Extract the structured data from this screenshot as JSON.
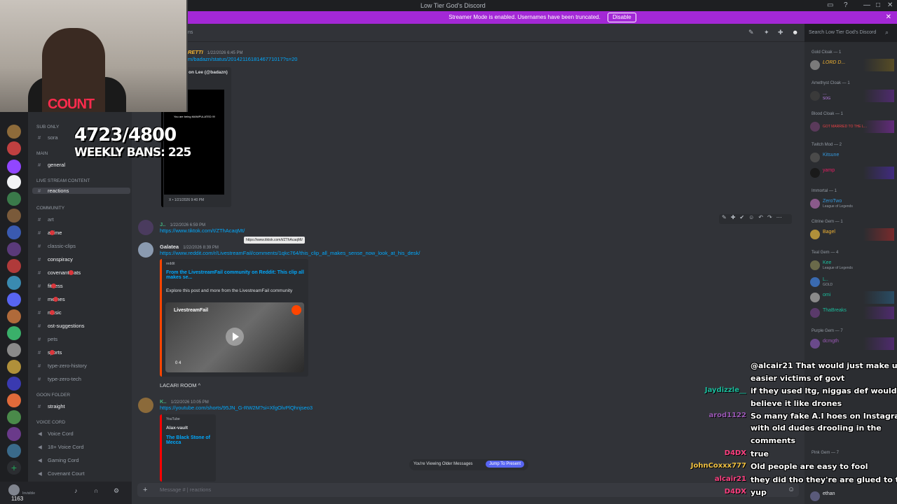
{
  "window": {
    "title": "Low Tier God's Discord"
  },
  "banner": {
    "text": "Streamer Mode is enabled. Usernames have been truncated.",
    "disable_label": "Disable"
  },
  "search": {
    "placeholder": "Search Low Tier God's Discord"
  },
  "overlay": {
    "counter": "4723/4800",
    "weekly_bans": "WEEKLY BANS: 225",
    "shirt_text": "COUNT"
  },
  "sidebar": {
    "categories": [
      {
        "label": "SUB ONLY"
      },
      {
        "label": "MAIN"
      },
      {
        "label": "LIVE STREAM CONTENT"
      },
      {
        "label": "COMMUNITY"
      },
      {
        "label": "GOON FOLDER"
      },
      {
        "label": "VOICE CORD"
      }
    ],
    "channels": [
      {
        "label": "sora"
      },
      {
        "label": "general"
      },
      {
        "label": "reactions"
      },
      {
        "label": "art"
      },
      {
        "label": "anime"
      },
      {
        "label": "classic-clips"
      },
      {
        "label": "conspiracy"
      },
      {
        "label": "covenant-eats"
      },
      {
        "label": "fitness"
      },
      {
        "label": "memes"
      },
      {
        "label": "music"
      },
      {
        "label": "ost-suggestions"
      },
      {
        "label": "pets"
      },
      {
        "label": "sports"
      },
      {
        "label": "type-zero-history"
      },
      {
        "label": "type-zero-tech"
      },
      {
        "label": "straight"
      },
      {
        "label": "Voice Cord"
      },
      {
        "label": "18+ Voice Cord"
      },
      {
        "label": "Gaming Cord"
      },
      {
        "label": "Covenant Court"
      }
    ]
  },
  "messages": {
    "m1_time": "1/22/2026 6:45 PM",
    "m1_link": "m/badazn/status/2014211618146771017?s=20",
    "m1_author": "on Lee (@badazn)",
    "m1_vidcap": "You are being MANIPULATED !!!!",
    "m1_footer": "X • 1/21/2026 9:40 PM",
    "m2_author": "J..",
    "m2_time": "1/22/2026 6:59 PM",
    "m2_link": "https://www.tiktok.com/t/ZThAcaqMt/",
    "m2_tooltip": "https://www.tiktok.com/t/ZThAcaqMt/",
    "m3_author": "Galatea",
    "m3_time": "1/22/2026 8:39 PM",
    "m3_link": "https://www.reddit.com/r/LivestreamFail/comments/1qkc764/this_clip_all_makes_sense_now_look_at_his_desk/",
    "m3_embed_provider": "reddit",
    "m3_embed_title": "From the LivestreamFail community on Reddit: This clip all makes se...",
    "m3_embed_desc": "Explore this post and more from the LivestreamFail community",
    "m3_video_badge": "LivestreamFail",
    "m3_video_stats": "0   4",
    "m3_caption": "LACARI ROOM ^",
    "m4_author": "K..",
    "m4_time": "1/22/2026 10:05 PM",
    "m4_link": "https://youtube.com/shorts/95JN_G-RW2M?si=XfgOlvPlQhnjseo3",
    "m4_embed_provider": "YouTube",
    "m4_embed_channel": "Alax-vault",
    "m4_embed_title": "The Black Stone of Mecca"
  },
  "viewing": {
    "text": "You're Viewing Older Messages",
    "jump_label": "Jump To Present"
  },
  "input": {
    "placeholder": "Message # | reactions"
  },
  "members": {
    "categories": [
      {
        "label": "Gold Cloak — 1"
      },
      {
        "label": "Amethyst Cloak — 1"
      },
      {
        "label": "Blood Cloak — 1"
      },
      {
        "label": "Twitch Mod — 2"
      },
      {
        "label": "Immortal — 1"
      },
      {
        "label": "Citrine Gem — 1"
      },
      {
        "label": "Teal Gem — 4"
      },
      {
        "label": "Purple Gem — 7"
      },
      {
        "label": "Pink Gem — 7"
      }
    ],
    "list": [
      {
        "name": "LORD D...",
        "sub": "GOLD"
      },
      {
        "name": "...",
        "sub": "SOG"
      },
      {
        "name": "GOT MARRIED TO THE L...",
        "sub": ""
      },
      {
        "name": "Kitsune",
        "sub": ""
      },
      {
        "name": "yamp",
        "sub": ""
      },
      {
        "name": "ZeroTwo",
        "sub": "League of Legends"
      },
      {
        "name": "Bagel",
        "sub": ""
      },
      {
        "name": "Kee",
        "sub": "League of Legends"
      },
      {
        "name": "L..",
        "sub": "GOLD"
      },
      {
        "name": "omi",
        "sub": ""
      },
      {
        "name": "ThaBreaks",
        "sub": ""
      },
      {
        "name": "dcmgth",
        "sub": ""
      },
      {
        "name": "ethan",
        "sub": ""
      }
    ]
  },
  "chat_overlay": [
    {
      "name": "",
      "text": "@alcair21 That would just make us"
    },
    {
      "name": "",
      "text": "easier victims of govt"
    },
    {
      "name": "Jaydizzle__",
      "text": "if they used ltg, niggas def would"
    },
    {
      "name": "",
      "text": "believe it like drones"
    },
    {
      "name": "arod1122",
      "text": "So many fake A.I hoes on Instagram"
    },
    {
      "name": "",
      "text": "with old dudes drooling in the"
    },
    {
      "name": "",
      "text": "comments"
    },
    {
      "name": "D4DX",
      "text": "true"
    },
    {
      "name": "JohnCoxxx777",
      "text": "Old people are easy to fool"
    },
    {
      "name": "alcair21",
      "text": "they did tho they're are glued to tik tok"
    },
    {
      "name": "D4DX",
      "text": "yup"
    }
  ],
  "user": {
    "status": "Invisible",
    "count": "1163"
  },
  "colors": {
    "accent": "#5865f2",
    "banner": "#a328d6",
    "link": "#00a8fc"
  }
}
